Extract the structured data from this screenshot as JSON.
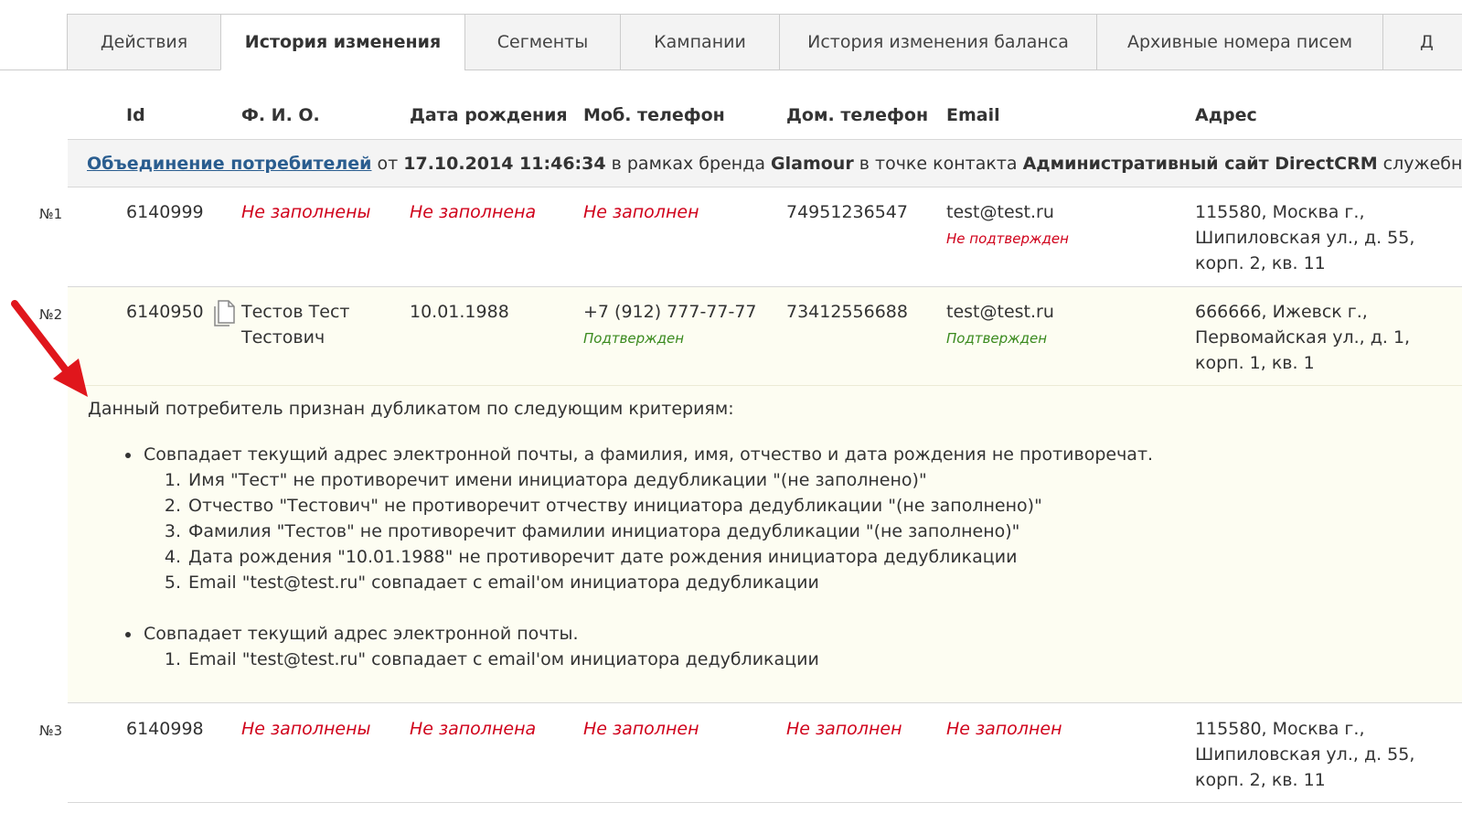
{
  "tabs": [
    {
      "label": "Действия",
      "active": false
    },
    {
      "label": "История изменения",
      "active": true
    },
    {
      "label": "Сегменты",
      "active": false
    },
    {
      "label": "Кампании",
      "active": false
    },
    {
      "label": "История изменения баланса",
      "active": false
    },
    {
      "label": "Архивные номера писем",
      "active": false
    },
    {
      "label": "Д",
      "active": false
    }
  ],
  "table": {
    "headers": {
      "id": "Id",
      "fio": "Ф. И. О.",
      "birth": "Дата рождения",
      "mobile": "Моб. телефон",
      "home": "Дом. телефон",
      "email": "Email",
      "address": "Адрес"
    }
  },
  "merge": {
    "link": "Объединение потребителей",
    "t1": " от ",
    "date": "17.10.2014 11:46:34",
    "t2": " в рамках бренда ",
    "brand": "Glamour",
    "t3": " в точке контакта ",
    "point": "Административный сайт DirectCRM",
    "t4": " служебным персоналом"
  },
  "rows": [
    {
      "num": "№1",
      "id": "6140999",
      "fio": "Не заполнены",
      "birth": "Не заполнена",
      "mobile": "Не заполнен",
      "home": "74951236547",
      "email": "test@test.ru",
      "email_status": "Не подтвержден",
      "address": [
        "115580, Москва г.,",
        "Шипиловская ул., д. 55,",
        "корп. 2, кв. 11"
      ]
    },
    {
      "num": "№2",
      "id": "6140950",
      "fio": [
        "Тестов Тест",
        "Тестович"
      ],
      "birth": "10.01.1988",
      "mobile": "+7 (912) 777-77-77",
      "mobile_status": "Подтвержден",
      "home": "73412556688",
      "email": "test@test.ru",
      "email_status": "Подтвержден",
      "address": [
        "666666, Ижевск г.,",
        "Первомайская ул., д. 1,",
        "корп. 1, кв. 1"
      ]
    },
    {
      "num": "№3",
      "id": "6140998",
      "fio": "Не заполнены",
      "birth": "Не заполнена",
      "mobile": "Не заполнен",
      "home": "Не заполнен",
      "email": "Не заполнен",
      "address": [
        "115580, Москва г.,",
        "Шипиловская ул., д. 55,",
        "корп. 2, кв. 11"
      ]
    }
  ],
  "duplicate": {
    "intro": "Данный потребитель признан дубликатом по следующим критериям:",
    "criteria": [
      {
        "text": "Совпадает текущий адрес электронной почты, а фамилия, имя, отчество и дата рождения не противоречат.",
        "items": [
          "Имя \"Тест\" не противоречит имени инициатора дедубликации \"(не заполнено)\"",
          "Отчество \"Тестович\" не противоречит отчеству инициатора дедубликации \"(не заполнено)\"",
          "Фамилия \"Тестов\" не противоречит фамилии инициатора дедубликации \"(не заполнено)\"",
          "Дата рождения \"10.01.1988\" не противоречит дате рождения инициатора дедубликации",
          "Email \"test@test.ru\" совпадает с email'ом инициатора дедубликации"
        ]
      },
      {
        "text": "Совпадает текущий адрес электронной почты.",
        "items": [
          "Email \"test@test.ru\" совпадает с email'ом инициатора дедубликации"
        ]
      }
    ]
  },
  "colors": {
    "empty": "#d0021b",
    "confirmed": "#3a8a1e",
    "link": "#2a5d8f",
    "highlight": "#fdfdf2",
    "arrow": "#e0161c"
  },
  "icons": {
    "copy": "document-copy-icon",
    "arrow": "red-arrow-annotation"
  }
}
